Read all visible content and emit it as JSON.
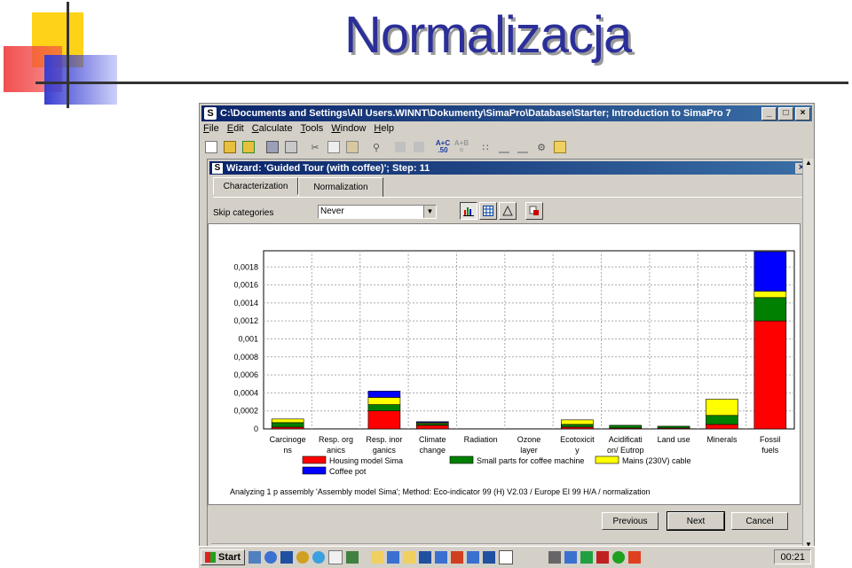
{
  "slide": {
    "title": "Normalizacja"
  },
  "window": {
    "title": "C:\\Documents and Settings\\All Users.WINNT\\Dokumenty\\SimaPro\\Database\\Starter; Introduction to SimaPro 7",
    "app_icon": "S",
    "controls": [
      "_",
      "□",
      "×"
    ]
  },
  "menu": [
    "File",
    "Edit",
    "Calculate",
    "Tools",
    "Window",
    "Help"
  ],
  "toolbar": {
    "formula_a": "A+C",
    "formula_a_sub": ".50",
    "formula_b": "A+B",
    "formula_b_sub": "="
  },
  "wizard": {
    "title": "Wizard: 'Guided Tour (with coffee)';  Step: 11",
    "close": "×",
    "tabs": [
      {
        "label": "Characterization",
        "active": false
      },
      {
        "label": "Normalization",
        "active": true
      }
    ],
    "skip_label": "Skip categories",
    "skip_value": "Never",
    "status": "Analyzing 1 p assembly 'Assembly model Sima';  Method: Eco-indicator 99 (H) V2.03 /  Europe EI 99 H/A / normalization",
    "buttons": {
      "previous": "Previous",
      "next": "Next",
      "cancel": "Cancel"
    }
  },
  "taskbar": {
    "start": "Start",
    "clock": "00:21"
  },
  "colors": {
    "housing": "#ff0000",
    "small_parts": "#008000",
    "mains": "#ffff00",
    "coffee_pot": "#0000ff"
  },
  "chart_data": {
    "type": "bar",
    "stacked": true,
    "categories": [
      [
        "Carcinoge",
        "ns"
      ],
      [
        "Resp. org",
        "anics"
      ],
      [
        "Resp. inor",
        "ganics"
      ],
      [
        "Climate",
        "change"
      ],
      [
        "Radiation",
        ""
      ],
      [
        "Ozone",
        "layer"
      ],
      [
        "Ecotoxicit",
        "y"
      ],
      [
        "Acidificati",
        "on/ Eutrop"
      ],
      [
        "Land use",
        ""
      ],
      [
        "Minerals",
        ""
      ],
      [
        "Fossil",
        "fuels"
      ]
    ],
    "series": [
      {
        "name": "Housing model Sima",
        "color": "#ff0000",
        "values": [
          2e-05,
          0,
          0.0002,
          4e-05,
          0,
          0,
          2e-05,
          1e-05,
          1e-05,
          5e-05,
          0.0012
        ]
      },
      {
        "name": "Small parts for coffee machine",
        "color": "#008000",
        "values": [
          5e-05,
          0,
          7e-05,
          2e-05,
          0,
          0,
          3e-05,
          3e-05,
          2e-05,
          0.0001,
          0.00026
        ]
      },
      {
        "name": "Mains (230V) cable",
        "color": "#ffff00",
        "values": [
          4e-05,
          0,
          8e-05,
          1e-05,
          0,
          0,
          5e-05,
          0,
          0,
          0.00018,
          7e-05
        ]
      },
      {
        "name": "Coffee pot",
        "color": "#0000ff",
        "values": [
          0,
          0,
          7e-05,
          1e-05,
          0,
          0,
          0,
          0,
          0,
          0,
          0.00044
        ]
      }
    ],
    "y_ticks": [
      "0",
      "0,0002",
      "0,0004",
      "0,0006",
      "0,0008",
      "0,001",
      "0,0012",
      "0,0014",
      "0,0016",
      "0,0018"
    ],
    "ylim": [
      0,
      0.00198
    ],
    "grid": true,
    "legend_position": "bottom"
  }
}
